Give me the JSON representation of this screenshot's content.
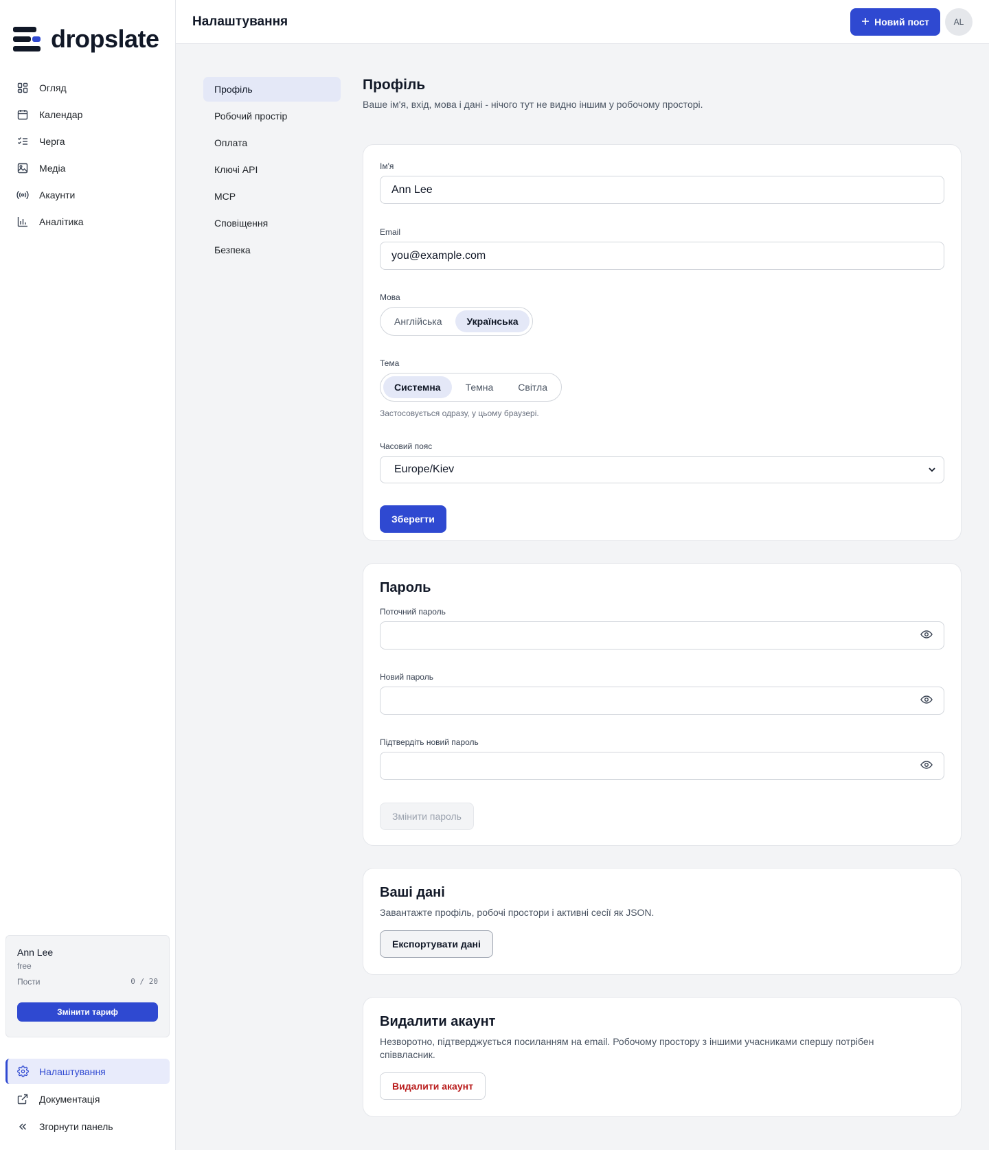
{
  "brand": {
    "name": "dropslate",
    "accent": "#2f49d1"
  },
  "sidebar": {
    "items": [
      {
        "label": "Огляд",
        "icon": "grid-icon"
      },
      {
        "label": "Календар",
        "icon": "calendar-icon"
      },
      {
        "label": "Черга",
        "icon": "list-check-icon"
      },
      {
        "label": "Медіа",
        "icon": "image-icon"
      },
      {
        "label": "Акаунти",
        "icon": "broadcast-icon"
      },
      {
        "label": "Аналітика",
        "icon": "bar-chart-icon"
      }
    ],
    "plan": {
      "user_name": "Ann Lee",
      "tier": "free",
      "posts_label": "Пости",
      "posts_used": "0",
      "posts_sep": "/",
      "posts_limit": "20",
      "upgrade_label": "Змінити тариф"
    },
    "bottom": [
      {
        "label": "Налаштування",
        "icon": "gear-icon",
        "active": true
      },
      {
        "label": "Документація",
        "icon": "external-link-icon"
      },
      {
        "label": "Згорнути панель",
        "icon": "chevrons-left-icon"
      }
    ]
  },
  "header": {
    "title": "Налаштування",
    "new_post_label": "Новий пост",
    "avatar_initials": "AL"
  },
  "settings_nav": [
    {
      "label": "Профіль",
      "active": true
    },
    {
      "label": "Робочий простір"
    },
    {
      "label": "Оплата"
    },
    {
      "label": "Ключі API"
    },
    {
      "label": "MCP"
    },
    {
      "label": "Сповіщення"
    },
    {
      "label": "Безпека"
    }
  ],
  "profile": {
    "title": "Профіль",
    "subtitle": "Ваше ім'я, вхід, мова і дані - нічого тут не видно іншим у робочому просторі.",
    "name_label": "Ім'я",
    "name_value": "Ann Lee",
    "email_label": "Email",
    "email_value": "you@example.com",
    "language_label": "Мова",
    "languages": [
      "Англійська",
      "Українська"
    ],
    "language_selected": "Українська",
    "theme_label": "Тема",
    "themes": [
      "Системна",
      "Темна",
      "Світла"
    ],
    "theme_selected": "Системна",
    "theme_hint": "Застосовується одразу, у цьому браузері.",
    "timezone_label": "Часовий пояс",
    "timezone_value": "Europe/Kiev",
    "save_label": "Зберегти"
  },
  "password": {
    "title": "Пароль",
    "current_label": "Поточний пароль",
    "new_label": "Новий пароль",
    "confirm_label": "Підтвердіть новий пароль",
    "submit_label": "Змінити пароль"
  },
  "data_export": {
    "title": "Ваші дані",
    "description": "Завантажте профіль, робочі простори і активні сесії як JSON.",
    "button_label": "Експортувати дані"
  },
  "delete_account": {
    "title": "Видалити акаунт",
    "description": "Незворотно, підтверджується посиланням на email. Робочому простору з іншими учасниками спершу потрібен співвласник.",
    "button_label": "Видалити акаунт"
  }
}
